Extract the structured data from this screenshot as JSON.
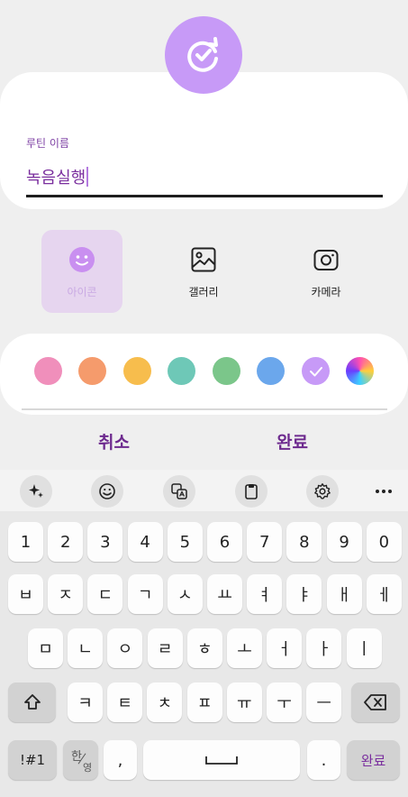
{
  "routine": {
    "name_label": "루틴 이름",
    "name_value": "녹음실행"
  },
  "type_options": [
    {
      "label": "아이콘",
      "icon": "smiley-icon",
      "selected": true
    },
    {
      "label": "갤러리",
      "icon": "image-icon",
      "selected": false
    },
    {
      "label": "카메라",
      "icon": "camera-icon",
      "selected": false
    }
  ],
  "colors": [
    "#f08fbb",
    "#f59b6c",
    "#f7bd4d",
    "#6ec8b7",
    "#7bc68a",
    "#6ba7ec",
    "#c79af7",
    "rainbow"
  ],
  "selected_color": "#c79af7",
  "actions": {
    "cancel": "취소",
    "done": "완료"
  },
  "keyboard": {
    "toolbar": [
      "sparkle-icon",
      "emoji-icon",
      "translate-icon",
      "clipboard-icon",
      "settings-icon",
      "more-icon"
    ],
    "row_numbers": [
      "1",
      "2",
      "3",
      "4",
      "5",
      "6",
      "7",
      "8",
      "9",
      "0"
    ],
    "row1": [
      "ㅂ",
      "ㅈ",
      "ㄷ",
      "ㄱ",
      "ㅅ",
      "ㅛ",
      "ㅕ",
      "ㅑ",
      "ㅐ",
      "ㅔ"
    ],
    "row2": [
      "ㅁ",
      "ㄴ",
      "ㅇ",
      "ㄹ",
      "ㅎ",
      "ㅗ",
      "ㅓ",
      "ㅏ",
      "ㅣ"
    ],
    "row3": [
      "ㅋ",
      "ㅌ",
      "ㅊ",
      "ㅍ",
      "ㅠ",
      "ㅜ",
      "ㅡ"
    ],
    "symbols_key": "!#1",
    "lang_key_top": "한",
    "lang_key_bottom": "영",
    "comma_key": ",",
    "period_key": ".",
    "enter_key": "완료"
  }
}
